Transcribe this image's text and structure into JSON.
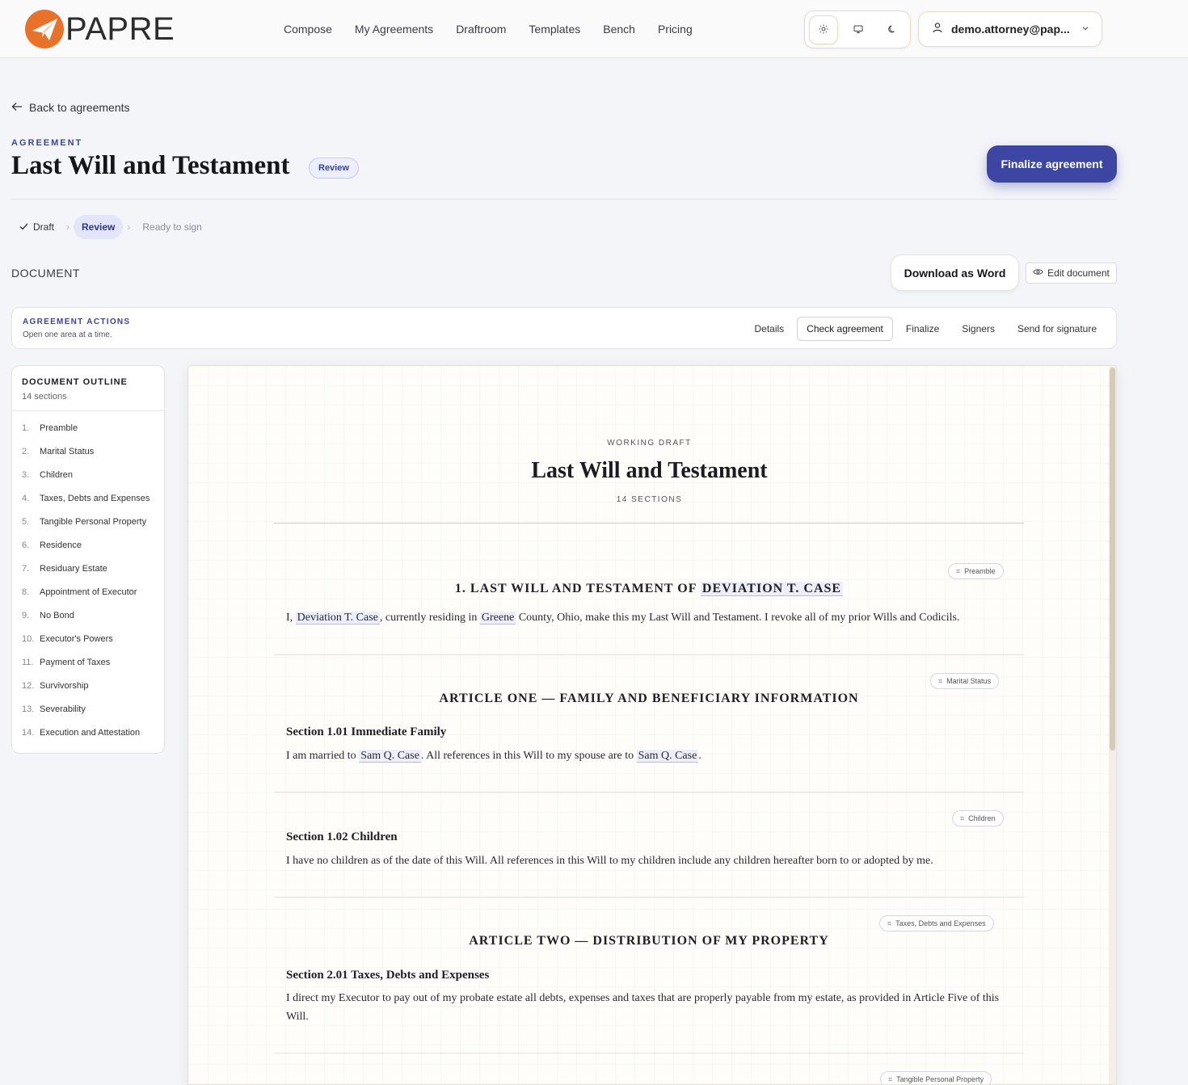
{
  "brand": {
    "name": "PAPRE",
    "logo_color": "#e9722b"
  },
  "nav": [
    "Compose",
    "My Agreements",
    "Draftroom",
    "Templates",
    "Bench",
    "Pricing"
  ],
  "theme_modes": [
    {
      "icon": "sun-icon",
      "active": true
    },
    {
      "icon": "monitor-icon",
      "active": false
    },
    {
      "icon": "moon-icon",
      "active": false
    }
  ],
  "user": {
    "label": "demo.attorney@pap...",
    "icon": "user-icon"
  },
  "header": {
    "back_label": "Back to agreements",
    "eyebrow": "AGREEMENT",
    "title": "Last Will and Testament",
    "status": "Review",
    "finalize_label": "Finalize agreement"
  },
  "stepper": [
    {
      "label": "Draft",
      "state": "done"
    },
    {
      "label": "Review",
      "state": "current"
    },
    {
      "label": "Ready to sign",
      "state": "future"
    }
  ],
  "document_bar": {
    "label": "DOCUMENT",
    "download_label": "Download as Word",
    "edit_label": "Edit document"
  },
  "actions": {
    "title": "AGREEMENT ACTIONS",
    "subtitle": "Open one area at a time.",
    "tabs": [
      "Details",
      "Check agreement",
      "Finalize",
      "Signers",
      "Send for signature"
    ],
    "active_tab": "Check agreement"
  },
  "outline": {
    "title": "DOCUMENT OUTLINE",
    "count": "14 sections",
    "items": [
      {
        "num": "1.",
        "label": "Preamble"
      },
      {
        "num": "2.",
        "label": "Marital Status"
      },
      {
        "num": "3.",
        "label": "Children"
      },
      {
        "num": "4.",
        "label": "Taxes, Debts and Expenses"
      },
      {
        "num": "5.",
        "label": "Tangible Personal Property"
      },
      {
        "num": "6.",
        "label": "Residence"
      },
      {
        "num": "7.",
        "label": "Residuary Estate"
      },
      {
        "num": "8.",
        "label": "Appointment of Executor"
      },
      {
        "num": "9.",
        "label": "No Bond"
      },
      {
        "num": "10.",
        "label": "Executor's Powers"
      },
      {
        "num": "11.",
        "label": "Payment of Taxes"
      },
      {
        "num": "12.",
        "label": "Survivorship"
      },
      {
        "num": "13.",
        "label": "Severability"
      },
      {
        "num": "14.",
        "label": "Execution and Attestation"
      }
    ]
  },
  "document": {
    "eyebrow": "WORKING DRAFT",
    "title": "Last Will and Testament",
    "sections_label": "14 SECTIONS",
    "preamble": {
      "tag": "Preamble",
      "heading_prefix": "1. LAST WILL AND TESTAMENT OF",
      "heading_name": "DEVIATION T. CASE",
      "p1": "I,",
      "testator": "Deviation T. Case",
      "p2": ", currently residing in",
      "county": "Greene",
      "p3": "County, Ohio, make this my Last Will and Testament. I revoke all of my prior Wills and Codicils."
    },
    "marital": {
      "tag": "Marital Status",
      "article": "ARTICLE ONE — FAMILY AND BENEFICIARY INFORMATION",
      "section": "Section 1.01 Immediate Family",
      "p1": "I am married to",
      "spouse": "Sam Q. Case",
      "p2": ". All references in this Will to my spouse are to",
      "spouse2": "Sam Q. Case",
      "p3": "."
    },
    "children": {
      "tag": "Children",
      "section": "Section 1.02 Children",
      "text": "I have no children as of the date of this Will. All references in this Will to my children include any children hereafter born to or adopted by me."
    },
    "taxes": {
      "tag": "Taxes, Debts and Expenses",
      "article": "ARTICLE TWO — DISTRIBUTION OF MY PROPERTY",
      "section": "Section 2.01 Taxes, Debts and Expenses",
      "text": "I direct my Executor to pay out of my probate estate all debts, expenses and taxes that are properly payable from my estate, as provided in Article Five of this Will."
    },
    "tangible": {
      "tag": "Tangible Personal Property"
    }
  },
  "colors": {
    "accent": "#3e46a3",
    "paper": "#fefdf9",
    "highlight": "#eceefa"
  }
}
